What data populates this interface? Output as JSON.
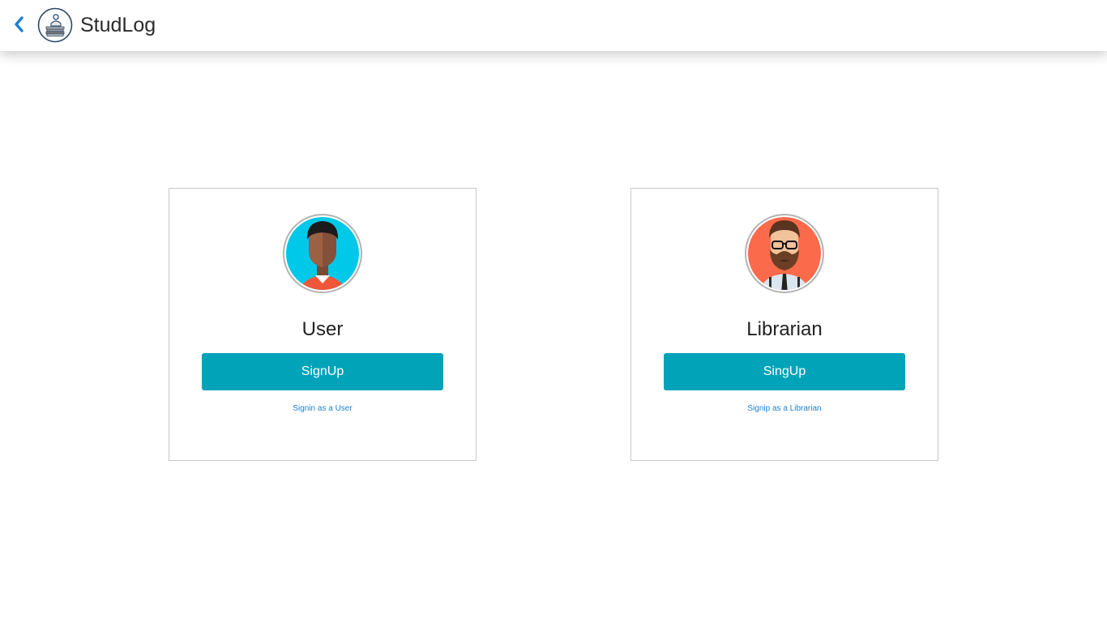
{
  "app": {
    "title": "StudLog",
    "back_icon": "chevron-left-icon",
    "logo_icon": "student-books-logo",
    "accent_color": "#00a3b8",
    "link_color": "#1e7fd6"
  },
  "cards": [
    {
      "role": "User",
      "avatar": "user-avatar-icon",
      "signup_label": "SignUp",
      "signin_label": "Signin as a User"
    },
    {
      "role": "Librarian",
      "avatar": "librarian-avatar-icon",
      "signup_label": "SingUp",
      "signin_label": "Signip as a Librarian"
    }
  ]
}
